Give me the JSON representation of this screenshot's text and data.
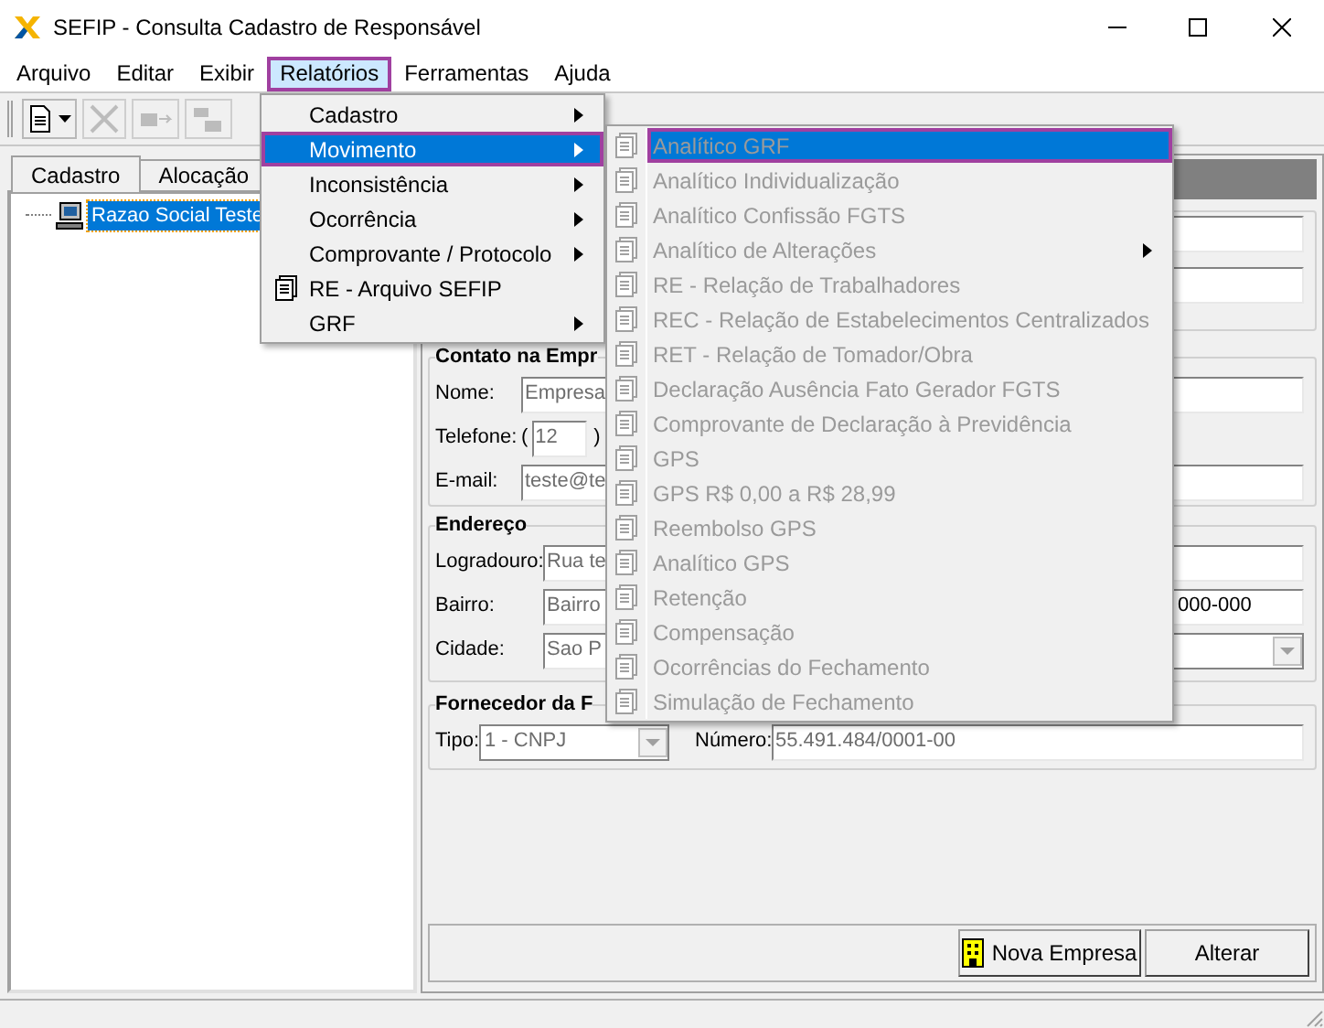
{
  "window": {
    "title": "SEFIP - Consulta Cadastro de Responsável"
  },
  "menu_bar": [
    {
      "label": "Arquivo",
      "selected": false
    },
    {
      "label": "Editar",
      "selected": false
    },
    {
      "label": "Exibir",
      "selected": false
    },
    {
      "label": "Relatórios",
      "selected": true
    },
    {
      "label": "Ferramentas",
      "selected": false
    },
    {
      "label": "Ajuda",
      "selected": false
    }
  ],
  "toolbar": [
    {
      "kind": "new",
      "disabled": false
    },
    {
      "kind": "delete",
      "disabled": true
    },
    {
      "kind": "move",
      "disabled": true
    },
    {
      "kind": "copy",
      "disabled": true
    }
  ],
  "tabs": [
    {
      "label": "Cadastro",
      "selected": true
    },
    {
      "label": "Alocação",
      "selected": false
    }
  ],
  "tree": [
    {
      "label": "Razao Social Teste",
      "selected": true
    }
  ],
  "contact": {
    "title": "Contato na Empr",
    "name_label": "Nome:",
    "name": "Empresa",
    "phone_label": "Telefone:",
    "phone_open": "(",
    "area_code": "12",
    "phone_close": ")",
    "email_label": "E-mail:",
    "email": "teste@te"
  },
  "address": {
    "title": "Endereço",
    "street_label": "Logradouro:",
    "street": "Rua te",
    "district_label": "Bairro:",
    "district": "Bairro",
    "zip": "000-000",
    "city_label": "Cidade:",
    "city": "Sao P"
  },
  "supplier": {
    "title": "Fornecedor da F",
    "type_label": "Tipo:",
    "type": "1 - CNPJ",
    "number_label": "Número:",
    "number": "55.491.484/0001-00"
  },
  "buttons": [
    {
      "kind": "new",
      "label": "Nova Empresa"
    },
    {
      "kind": "plain",
      "label": "Alterar"
    }
  ],
  "menu": [
    {
      "label": "Cadastro",
      "submenu": true,
      "icon": false,
      "selected": false
    },
    {
      "label": "Movimento",
      "submenu": true,
      "icon": false,
      "selected": true
    },
    {
      "label": "Inconsistência",
      "submenu": true,
      "icon": false,
      "selected": false
    },
    {
      "label": "Ocorrência",
      "submenu": true,
      "icon": false,
      "selected": false
    },
    {
      "label": "Comprovante / Protocolo",
      "submenu": true,
      "icon": false,
      "selected": false
    },
    {
      "label": "RE - Arquivo SEFIP",
      "submenu": false,
      "icon": true,
      "selected": false
    },
    {
      "label": "GRF",
      "submenu": true,
      "icon": false,
      "selected": false
    }
  ],
  "submenu": [
    {
      "label": "Analítico GRF",
      "submenu": false,
      "disabled": true,
      "selected": true
    },
    {
      "label": "Analítico Individualização",
      "submenu": false,
      "disabled": true,
      "selected": false
    },
    {
      "label": "Analítico Confissão FGTS",
      "submenu": false,
      "disabled": true,
      "selected": false
    },
    {
      "label": "Analítico de Alterações",
      "submenu": true,
      "disabled": true,
      "selected": false
    },
    {
      "label": "RE - Relação de Trabalhadores",
      "submenu": false,
      "disabled": true,
      "selected": false
    },
    {
      "label": "REC - Relação de Estabelecimentos Centralizados",
      "submenu": false,
      "disabled": true,
      "selected": false
    },
    {
      "label": "RET - Relação de Tomador/Obra",
      "submenu": false,
      "disabled": true,
      "selected": false
    },
    {
      "label": "Declaração Ausência Fato Gerador FGTS",
      "submenu": false,
      "disabled": true,
      "selected": false
    },
    {
      "label": "Comprovante de Declaração à Previdência",
      "submenu": false,
      "disabled": true,
      "selected": false
    },
    {
      "label": "GPS",
      "submenu": false,
      "disabled": true,
      "selected": false
    },
    {
      "label": "GPS R$ 0,00 a R$ 28,99",
      "submenu": false,
      "disabled": true,
      "selected": false
    },
    {
      "label": "Reembolso GPS",
      "submenu": false,
      "disabled": true,
      "selected": false
    },
    {
      "label": "Analítico GPS",
      "submenu": false,
      "disabled": true,
      "selected": false
    },
    {
      "label": "Retenção",
      "submenu": false,
      "disabled": true,
      "selected": false
    },
    {
      "label": "Compensação",
      "submenu": false,
      "disabled": true,
      "selected": false
    },
    {
      "label": "Ocorrências do Fechamento",
      "submenu": false,
      "disabled": true,
      "selected": false
    },
    {
      "label": "Simulação de Fechamento",
      "submenu": false,
      "disabled": true,
      "selected": false
    }
  ]
}
